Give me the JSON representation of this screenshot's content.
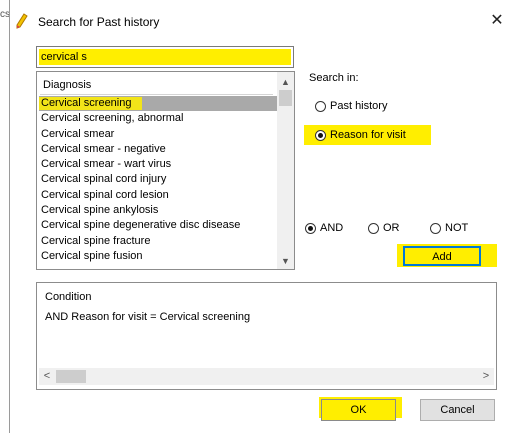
{
  "window": {
    "title": "Search for Past history",
    "close_glyph": "✕",
    "title_icon": "pencil-icon",
    "outer_glyph": "cs"
  },
  "search": {
    "value": "cervical s"
  },
  "list": {
    "header": "Diagnosis",
    "items": [
      "Cervical screening",
      "Cervical screening, abnormal",
      "Cervical smear",
      "Cervical smear - negative",
      "Cervical smear - wart virus",
      "Cervical spinal cord injury",
      "Cervical spinal cord lesion",
      "Cervical spine ankylosis",
      "Cervical spine degenerative disc disease",
      "Cervical spine fracture",
      "Cervical spine fusion"
    ],
    "selected_index": 0,
    "scroll_up": "▲",
    "scroll_down": "▼"
  },
  "search_in": {
    "label": "Search in:",
    "options": [
      "Past history",
      "Reason for visit"
    ],
    "selected": "Reason for visit"
  },
  "logic": {
    "options": [
      "AND",
      "OR",
      "NOT"
    ],
    "selected": "AND"
  },
  "buttons": {
    "add": "Add",
    "ok": "OK",
    "cancel": "Cancel"
  },
  "condition": {
    "title": "Condition",
    "text": "AND Reason for visit = Cervical screening",
    "scroll_left": "<",
    "scroll_right": ">"
  },
  "colors": {
    "highlight": "#ffee00",
    "selection": "#a9a9a9",
    "focus_border": "#0078d7"
  }
}
